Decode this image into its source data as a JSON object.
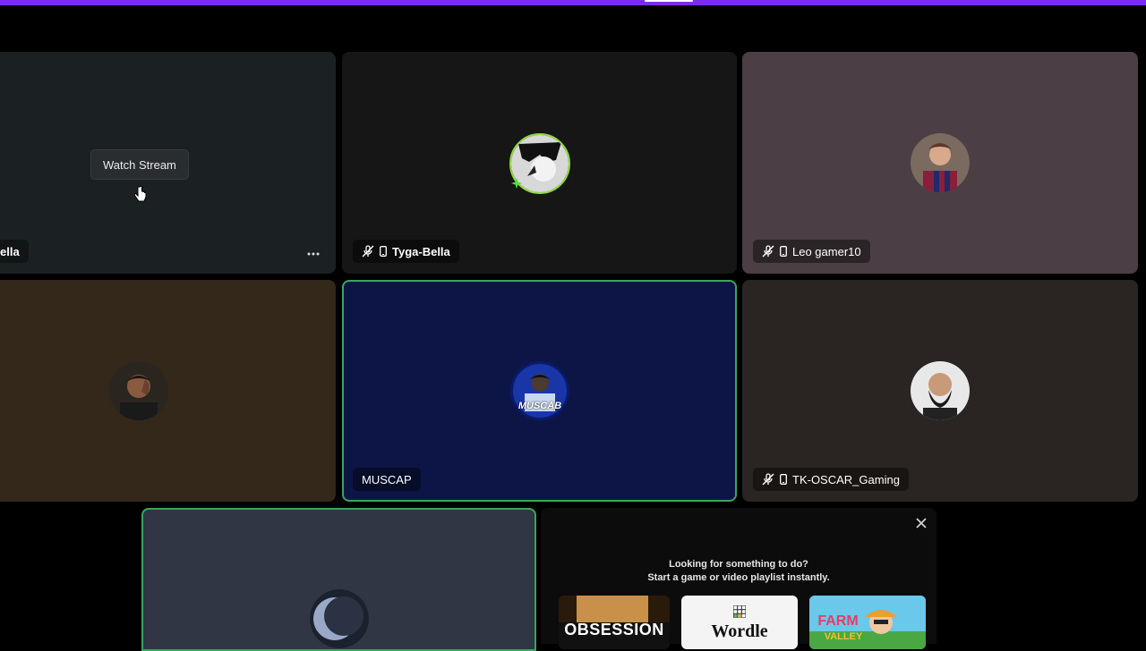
{
  "accent_color": "#7b2cf0",
  "speaking_color": "#3ba55d",
  "tiles": [
    {
      "name": "Bella",
      "name_visible": "ella",
      "bg": "#1c2224",
      "watch_label": "Watch Stream"
    },
    {
      "name": "Tyga-Bella",
      "bg": "#161617",
      "icons": [
        "mic-muted-icon",
        "mobile-icon"
      ]
    },
    {
      "name": "Leo gamer10",
      "bg": "#4b3e44",
      "icons": [
        "mic-muted-icon",
        "mobile-icon"
      ]
    },
    {
      "name": "",
      "bg": "#33281a"
    },
    {
      "name": "MUSCAP",
      "bg": "#0d1547",
      "speaking": true,
      "avatar_text": "MUSCAB"
    },
    {
      "name": "TK-OSCAR_Gaming",
      "bg": "#2a2522",
      "icons": [
        "mic-muted-icon",
        "mobile-icon"
      ]
    },
    {
      "name": "",
      "bg": "#313644",
      "speaking": true
    }
  ],
  "activity_panel": {
    "title": "Looking for something to do?",
    "subtitle": "Start a game or video playlist instantly.",
    "cards": [
      {
        "label": "OBSESSION"
      },
      {
        "label": "Wordle"
      },
      {
        "label": "FARM",
        "label2": "VALLEY"
      }
    ]
  }
}
